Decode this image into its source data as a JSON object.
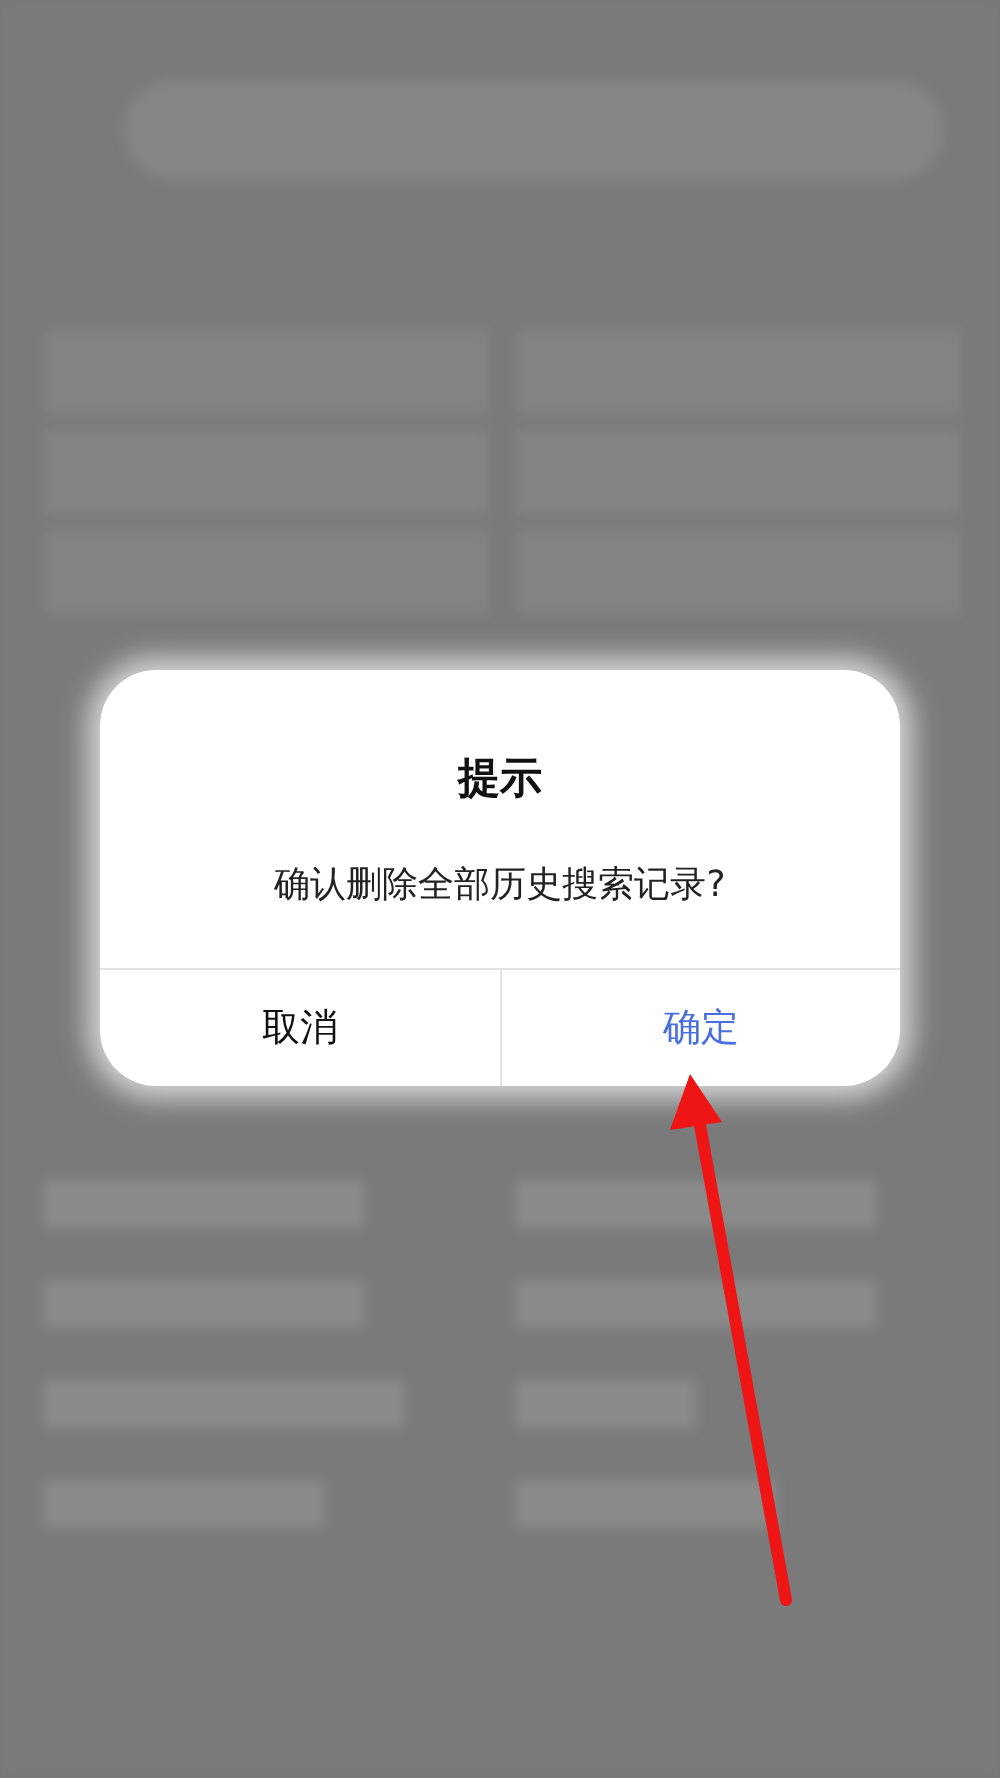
{
  "dialog": {
    "title": "提示",
    "message": "确认删除全部历史搜索记录?",
    "buttons": [
      {
        "label": "取消",
        "kind": "cancel"
      },
      {
        "label": "确定",
        "kind": "confirm"
      }
    ]
  }
}
